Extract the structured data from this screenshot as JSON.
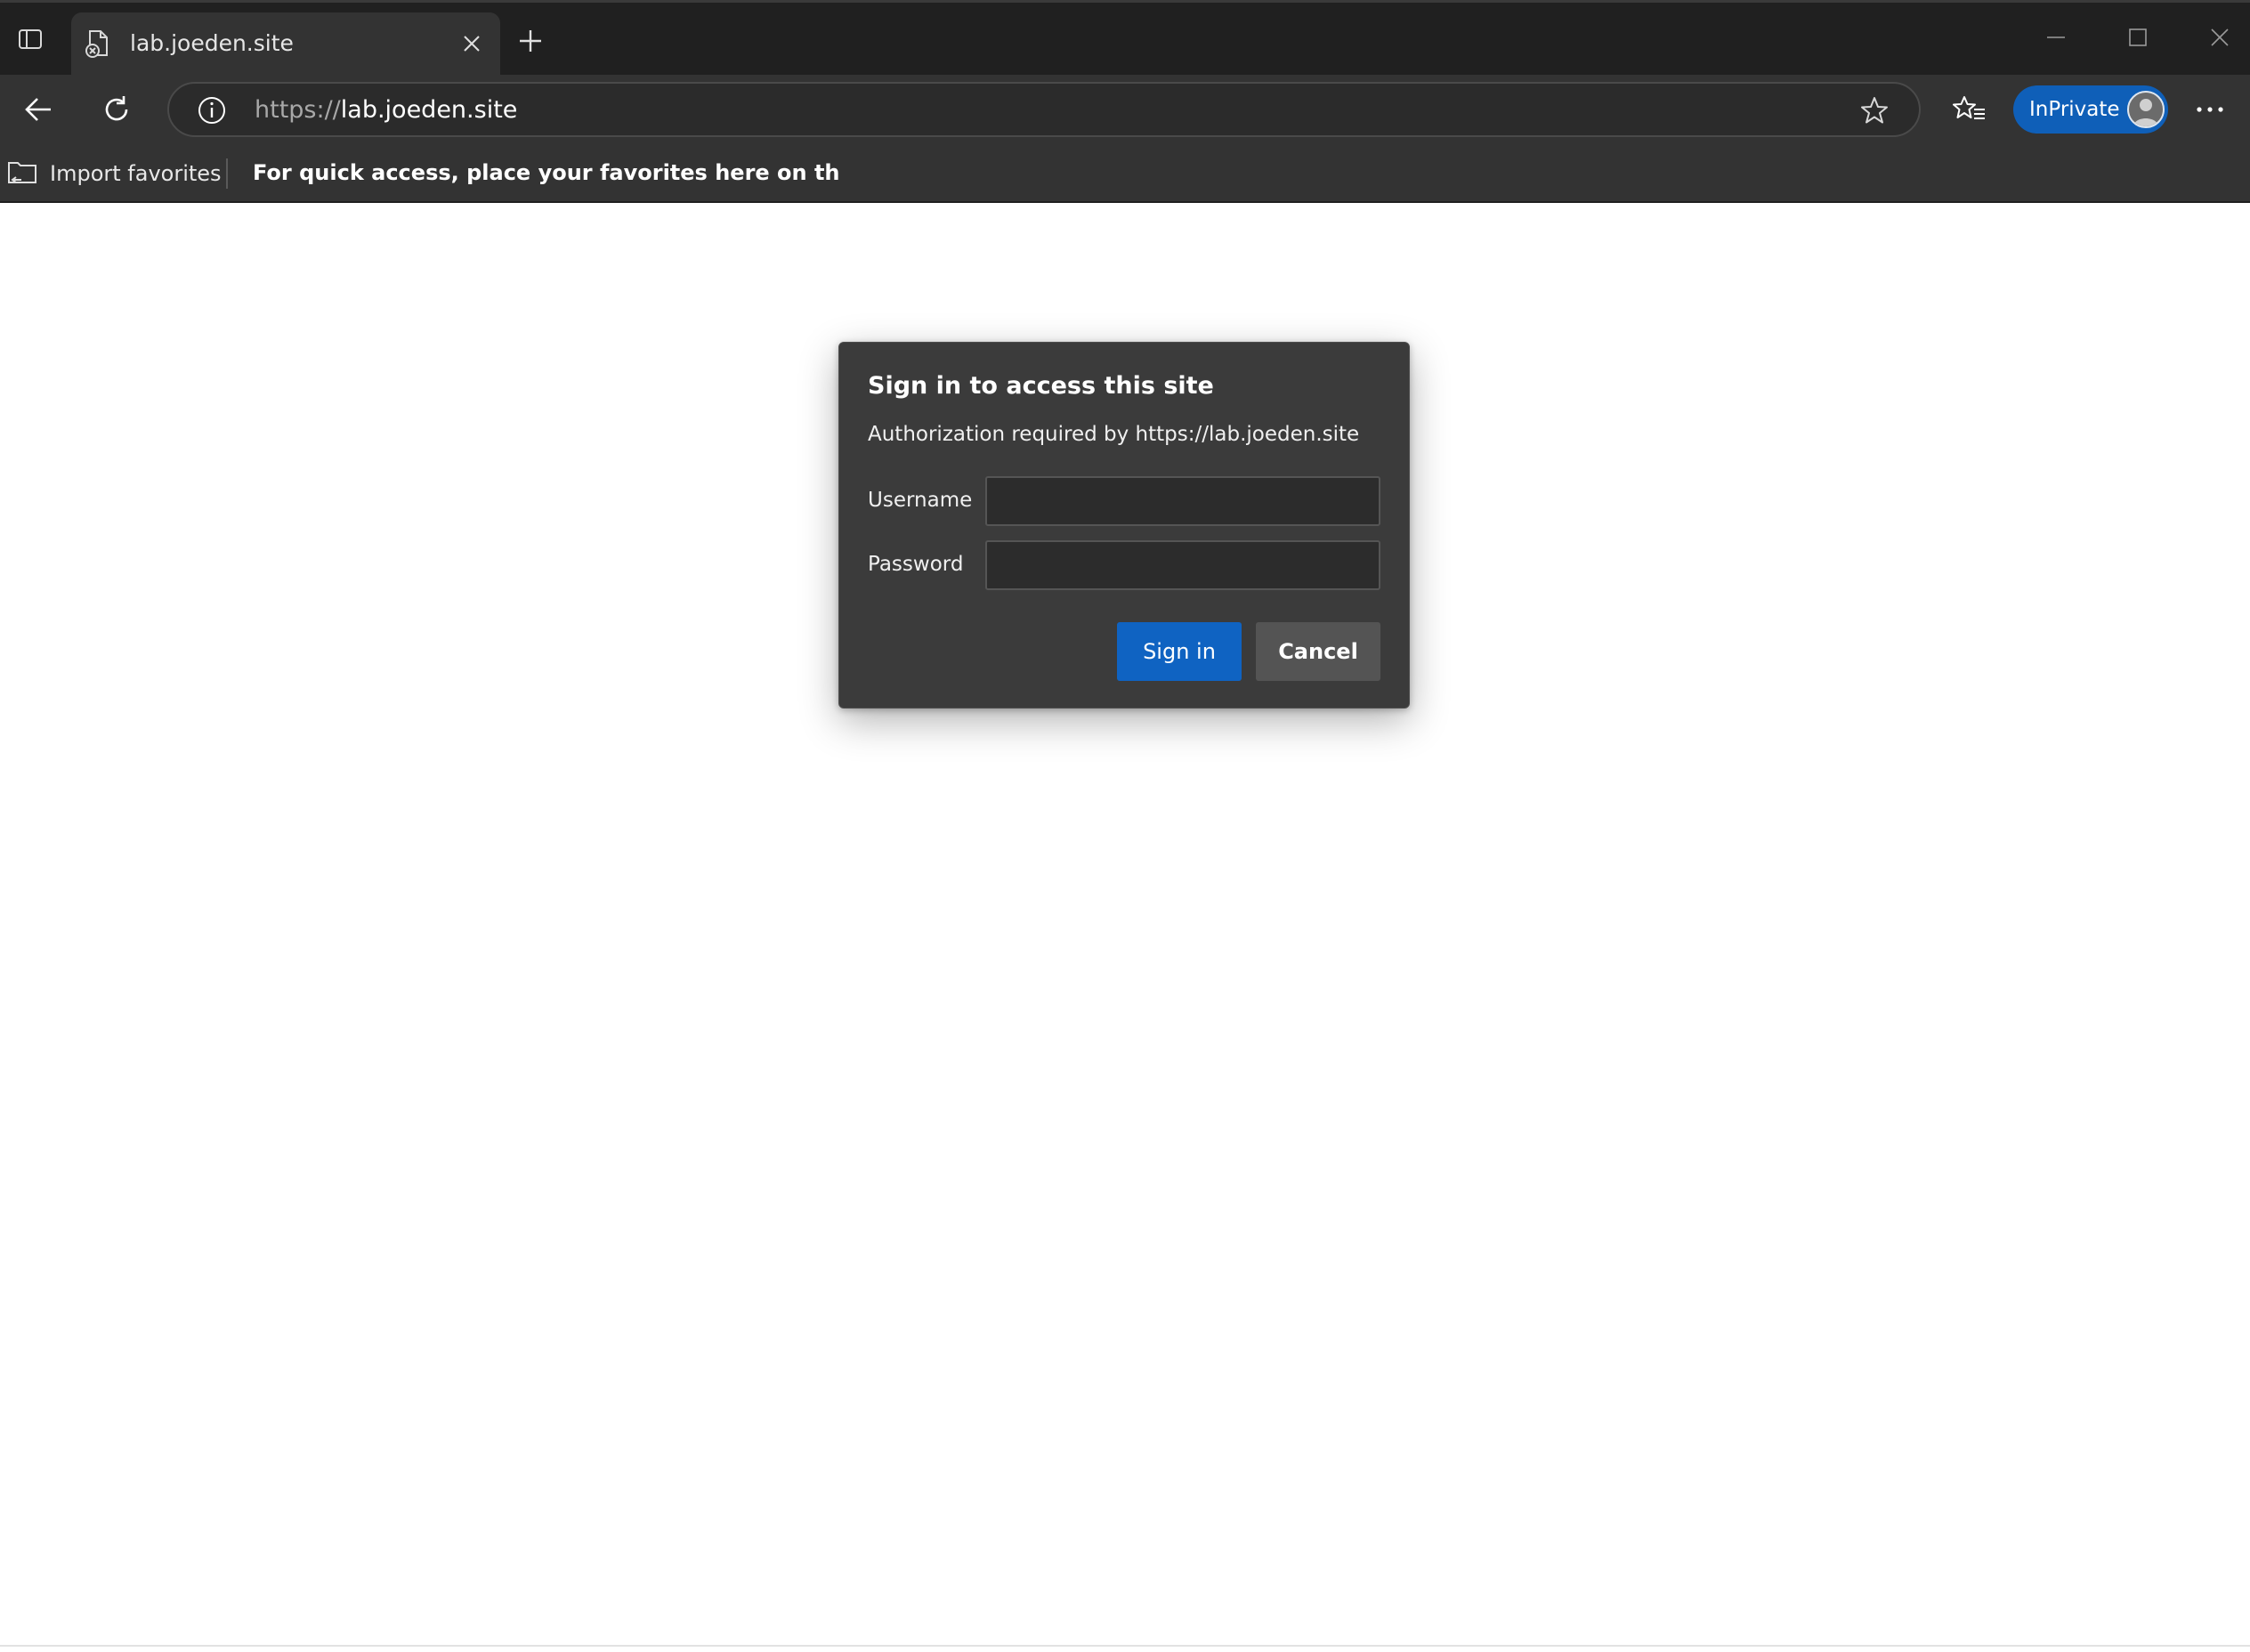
{
  "browser": {
    "tab": {
      "title": "lab.joeden.site",
      "favicon": "page-error-icon"
    },
    "address_bar": {
      "url_protocol": "https://",
      "url_host": "lab.joeden.site",
      "site_info_icon": "info-icon"
    },
    "profile": {
      "label": "InPrivate"
    },
    "favorites_bar": {
      "import_label": "Import favorites",
      "hint": "For quick access, place your favorites here on the favorites bar."
    },
    "colors": {
      "accent": "#0f63c2",
      "frame": "#202020",
      "toolbar": "#333333"
    }
  },
  "auth_dialog": {
    "title": "Sign in to access this site",
    "subtitle": "Authorization required by https://lab.joeden.site",
    "username_label": "Username",
    "username_value": "",
    "password_label": "Password",
    "password_value": "",
    "sign_in_label": "Sign in",
    "cancel_label": "Cancel"
  }
}
